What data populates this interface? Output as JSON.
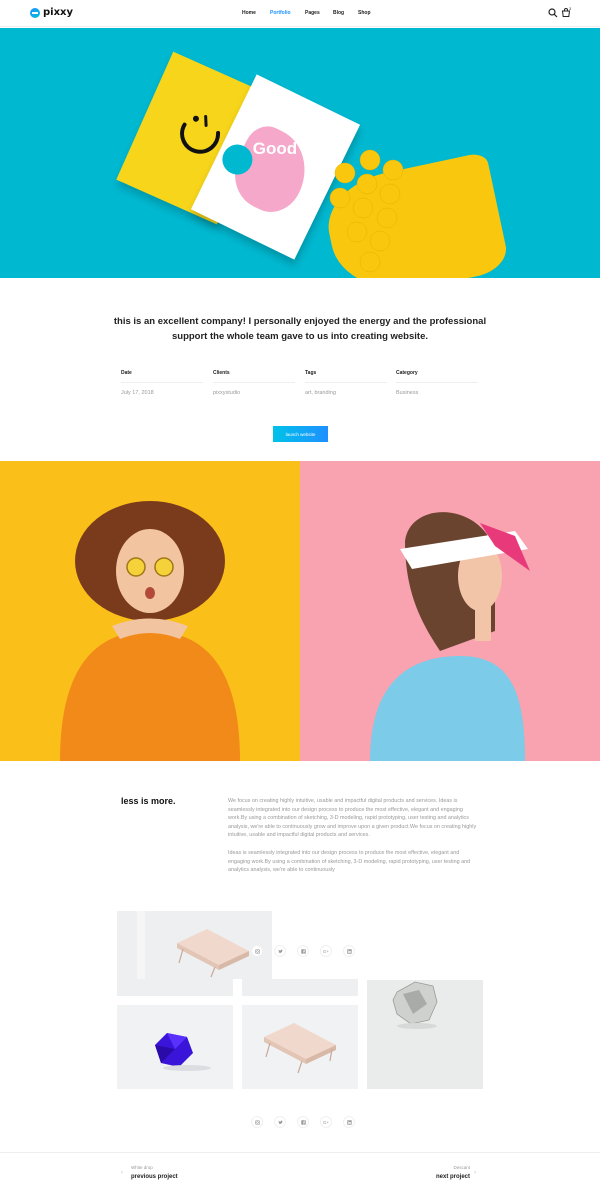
{
  "brand": {
    "name": "pixxy"
  },
  "nav": {
    "home": "Home",
    "portfolio": "Portfolio",
    "pages": "Pages",
    "blog": "Blog",
    "shop": "Shop"
  },
  "header": {
    "cart_count": "3"
  },
  "colors": {
    "accent": "#1e90ff",
    "hero_bg": "#00b8d0",
    "left_photo_bg": "#fbbf1a",
    "right_photo_bg": "#f9a3b0"
  },
  "hero": {
    "title": "Good cards"
  },
  "quote": {
    "text": "this is an excellent company! I personally enjoyed the energy and the professional support the whole team gave to us into creating website."
  },
  "meta": {
    "date_label": "Date",
    "date_value": "July 17, 2018",
    "clients_label": "Clients",
    "clients_value": "pixxystudio",
    "tags_label": "Tags",
    "tags_value": "art, branding",
    "category_label": "Category",
    "category_value": "Business"
  },
  "launch": {
    "label": "launch website"
  },
  "about": {
    "title": "less is more.",
    "paragraph1": "We focus on creating highly intuitive, usable and impactful digital products and services. Ideas is seamlessly integrated into our design process to produce the most effective, elegant and engaging work.By using a combination of sketching, 3-D modeling, rapid prototyping, user testing and analytics analysis, we're able to continuously grow and improve upon a given product.We focus on creating highly intuitive, usable and impactful digital products and services.",
    "paragraph2": "Ideas is seamlessly integrated into our design process to produce the most effective, elegant and engaging work.By using a combination of sketching, 3-D modeling, rapid prototyping, user testing and analytics analysis, we're able to continuously"
  },
  "social": {
    "icons": [
      "instagram-icon",
      "twitter-icon",
      "facebook-icon",
      "google-plus-icon",
      "linkedin-icon"
    ],
    "gplus": "G+"
  },
  "pagination": {
    "prev_small": "White drop",
    "prev_big": "previous project",
    "next_small": "Descant",
    "next_big": "next project"
  }
}
